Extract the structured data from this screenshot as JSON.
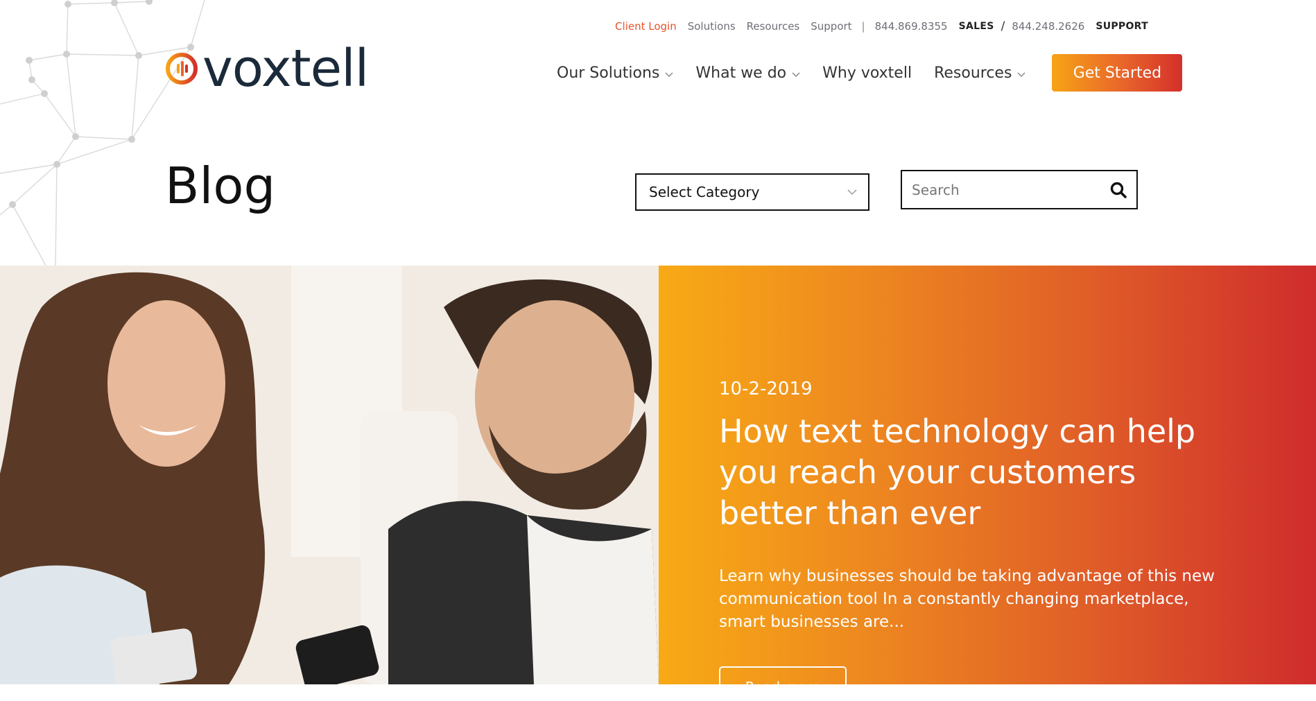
{
  "utility_nav": {
    "client_login": "Client Login",
    "solutions": "Solutions",
    "resources": "Resources",
    "support": "Support",
    "separator": "|",
    "sales_phone": "844.869.8355",
    "sales_label": "SALES",
    "slash": "/",
    "support_phone": "844.248.2626",
    "support_label": "SUPPORT"
  },
  "logo": {
    "text": "voxtell",
    "icon": "voxtell-logo-icon"
  },
  "main_nav": {
    "items": [
      {
        "label": "Our Solutions",
        "has_dropdown": true
      },
      {
        "label": "What we do",
        "has_dropdown": true
      },
      {
        "label": "Why voxtell",
        "has_dropdown": false
      },
      {
        "label": "Resources",
        "has_dropdown": true
      }
    ],
    "cta": "Get Started"
  },
  "page": {
    "title": "Blog"
  },
  "filters": {
    "category_selected": "Select Category",
    "search_placeholder": "Search"
  },
  "featured_post": {
    "date": "10-2-2019",
    "title": "How text technology can help you reach your customers better than ever",
    "excerpt": "Learn why businesses should be taking advantage of this new communication tool In a constantly changing marketplace, smart businesses are...",
    "button_label": "Read more"
  },
  "colors": {
    "accent": "#e8532a",
    "brand_dark": "#1b2a3a",
    "gradient_start": "#f8aa15",
    "gradient_end": "#cf2c2c"
  }
}
